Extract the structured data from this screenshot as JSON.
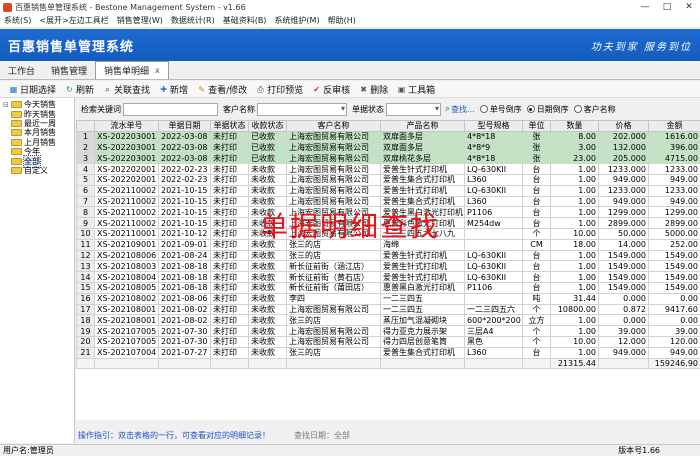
{
  "window": {
    "title": "百惠销售单管理系统 - Bestone Management System - v1.66",
    "controls": [
      "—",
      "□",
      "✕"
    ]
  },
  "menu": [
    "系统(S)",
    "<展开>左边工具栏",
    "销售管理(W)",
    "数据统计(R)",
    "基础资料(B)",
    "系统维护(M)",
    "帮助(H)"
  ],
  "banner": {
    "title": "百惠销售单管理系统",
    "slogan": "功夫到家  服务到位"
  },
  "tabs": [
    {
      "label": "工作台",
      "active": false
    },
    {
      "label": "销售管理",
      "active": false
    },
    {
      "label": "销售单明细",
      "active": true,
      "close": "x"
    }
  ],
  "toolbar": [
    {
      "icon": "calendar-icon",
      "glyph": "▦",
      "color": "#1e78d0",
      "label": "日期选择"
    },
    {
      "icon": "refresh-icon",
      "glyph": "↻",
      "color": "#2e9a3a",
      "label": "刷新"
    },
    {
      "icon": "search-icon",
      "glyph": "⌕",
      "color": "#333333",
      "label": "关联查找"
    },
    {
      "icon": "add-icon",
      "glyph": "✚",
      "color": "#1e78d0",
      "label": "新增"
    },
    {
      "icon": "edit-icon",
      "glyph": "✎",
      "color": "#c88a10",
      "label": "查看/修改"
    },
    {
      "icon": "print-icon",
      "glyph": "⎙",
      "color": "#555555",
      "label": "打印预览"
    },
    {
      "icon": "unapprove-icon",
      "glyph": "✔",
      "color": "#d22f2f",
      "label": "反审核"
    },
    {
      "icon": "delete-icon",
      "glyph": "✖",
      "color": "#555555",
      "label": "删除"
    },
    {
      "icon": "toolbox-icon",
      "glyph": "▣",
      "color": "#555555",
      "label": "工具箱"
    }
  ],
  "tree": {
    "root_toggle": "⊟",
    "items": [
      "今天销售",
      "昨天销售",
      "最近一周",
      "本月销售",
      "上月销售",
      "今年",
      "全部",
      "自定义"
    ],
    "selected": "全部"
  },
  "search": {
    "keyword_label": "检索关键词",
    "customer_label": "客户名称",
    "status_label": "单据状态",
    "find_label": "查找...",
    "sort_options": [
      {
        "label": "单号倒序",
        "checked": false
      },
      {
        "label": "日期倒序",
        "checked": true
      },
      {
        "label": "客户名称",
        "checked": false
      }
    ]
  },
  "table": {
    "columns": [
      "",
      "流水单号",
      "单据日期",
      "单据状态",
      "收款状态",
      "客户名称",
      "产品名称",
      "型号规格",
      "单位",
      "数量",
      "价格",
      "金额"
    ],
    "rows": [
      [
        "1",
        "XS-202203001",
        "2022-03-08",
        "未打印",
        "已收款",
        "上海宏图贸易有限公司",
        "双扉面多层",
        "4*8*18",
        "张",
        "8.00",
        "202.000",
        "1616.00"
      ],
      [
        "2",
        "XS-202203001",
        "2022-03-08",
        "未打印",
        "已收款",
        "上海宏图贸易有限公司",
        "双扉面多层",
        "4*8*9",
        "张",
        "3.00",
        "132.000",
        "396.00"
      ],
      [
        "3",
        "XS-202203001",
        "2022-03-08",
        "未打印",
        "已收款",
        "上海宏图贸易有限公司",
        "双扉桃花多层",
        "4*8*18",
        "张",
        "23.00",
        "205.000",
        "4715.00"
      ],
      [
        "4",
        "XS-202202001",
        "2022-02-23",
        "未打印",
        "未收款",
        "上海宏图贸易有限公司",
        "爱普生针式打印机",
        "LQ-630KII",
        "台",
        "1.00",
        "1233.000",
        "1233.00"
      ],
      [
        "5",
        "XS-202202001",
        "2022-02-23",
        "未打印",
        "未收款",
        "上海宏图贸易有限公司",
        "爱普生集合式打印机",
        "L360",
        "台",
        "1.00",
        "949.000",
        "949.00"
      ],
      [
        "6",
        "XS-202110002",
        "2021-10-15",
        "未打印",
        "未收款",
        "上海宏图贸易有限公司",
        "爱普生针式打印机",
        "LQ-630KII",
        "台",
        "1.00",
        "1233.000",
        "1233.00"
      ],
      [
        "7",
        "XS-202110002",
        "2021-10-15",
        "未打印",
        "未收款",
        "上海宏图贸易有限公司",
        "爱普生集合式打印机",
        "L360",
        "台",
        "1.00",
        "949.000",
        "949.00"
      ],
      [
        "8",
        "XS-202110002",
        "2021-10-15",
        "未打印",
        "未收款",
        "上海宏图贸易有限公司",
        "爱普生黑白激光打印机",
        "P1106",
        "台",
        "1.00",
        "1299.000",
        "1299.00"
      ],
      [
        "9",
        "XS-202110002",
        "2021-10-15",
        "未打印",
        "未收款",
        "上海宏图贸易有限公司",
        "惠普彩色激光打印机",
        "M254dw",
        "台",
        "1.00",
        "2899.000",
        "2899.00"
      ],
      [
        "10",
        "XS-202110001",
        "2021-10-12",
        "未打印",
        "未收款",
        "上海宏图贸易有限公司",
        "一二三四五六七八九",
        "",
        "个",
        "10.00",
        "50.000",
        "5000.00"
      ],
      [
        "11",
        "XS-202109001",
        "2021-09-01",
        "未打印",
        "未收款",
        "张三的店",
        "海绵",
        "",
        "CM",
        "18.00",
        "14.000",
        "252.00"
      ],
      [
        "12",
        "XS-202108006",
        "2021-08-24",
        "未打印",
        "未收款",
        "张三的店",
        "爱普生针式打印机",
        "LQ-630KII",
        "台",
        "1.00",
        "1549.000",
        "1549.00"
      ],
      [
        "13",
        "XS-202108003",
        "2021-08-18",
        "未打印",
        "未收款",
        "新长征前街（涵江店）",
        "爱普生针式打印机",
        "LQ-630KII",
        "台",
        "1.00",
        "1549.000",
        "1549.00"
      ],
      [
        "14",
        "XS-202108004",
        "2021-08-18",
        "未打印",
        "未收款",
        "新长征前街（黄石店）",
        "爱普生针式打印机",
        "LQ-630KII",
        "台",
        "1.00",
        "1549.000",
        "1549.00"
      ],
      [
        "15",
        "XS-202108005",
        "2021-08-18",
        "未打印",
        "未收款",
        "新长征前街（莆田店）",
        "惠普黑白激光打印机",
        "P1106",
        "台",
        "1.00",
        "1549.000",
        "1549.00"
      ],
      [
        "16",
        "XS-202108002",
        "2021-08-06",
        "未打印",
        "未收款",
        "李四",
        "一二三四五",
        "",
        "吨",
        "31.44",
        "0.000",
        "0.00"
      ],
      [
        "17",
        "XS-202108001",
        "2021-08-02",
        "未打印",
        "未收款",
        "上海宏图贸易有限公司",
        "一二三四五",
        "一二三四五六",
        "个",
        "10800.00",
        "0.872",
        "9417.60"
      ],
      [
        "18",
        "XS-202108001",
        "2021-08-02",
        "未打印",
        "未收款",
        "张三的店",
        "蒸压加气混凝砌块",
        "600*200*200",
        "立方",
        "1.00",
        "0.000",
        "0.00"
      ],
      [
        "19",
        "XS-202107005",
        "2021-07-30",
        "未打印",
        "未收款",
        "上海宏图贸易有限公司",
        "得力亚克力展示架",
        "三层A4",
        "个",
        "1.00",
        "39.000",
        "39.00"
      ],
      [
        "20",
        "XS-202107005",
        "2021-07-30",
        "未打印",
        "未收款",
        "上海宏图贸易有限公司",
        "得力四层创意笔筒",
        "黑色",
        "个",
        "10.00",
        "12.000",
        "120.00"
      ],
      [
        "21",
        "XS-202107004",
        "2021-07-27",
        "未打印",
        "未收款",
        "张三的店",
        "爱普生集合式打印机",
        "L360",
        "台",
        "1.00",
        "949.000",
        "949.00"
      ]
    ],
    "highlighted_rows": [
      0,
      1,
      2
    ],
    "totals": {
      "qty": "21315.44",
      "amount": "159246.90"
    }
  },
  "overlay_caption": "单据明细查找",
  "hint": {
    "tip": "操作指引：双击表格的一行，可查看对应的明细记录！",
    "query_date": "查找日期：全部"
  },
  "statusbar": {
    "user": "用户名:管理员",
    "version": "版本号1.66"
  }
}
